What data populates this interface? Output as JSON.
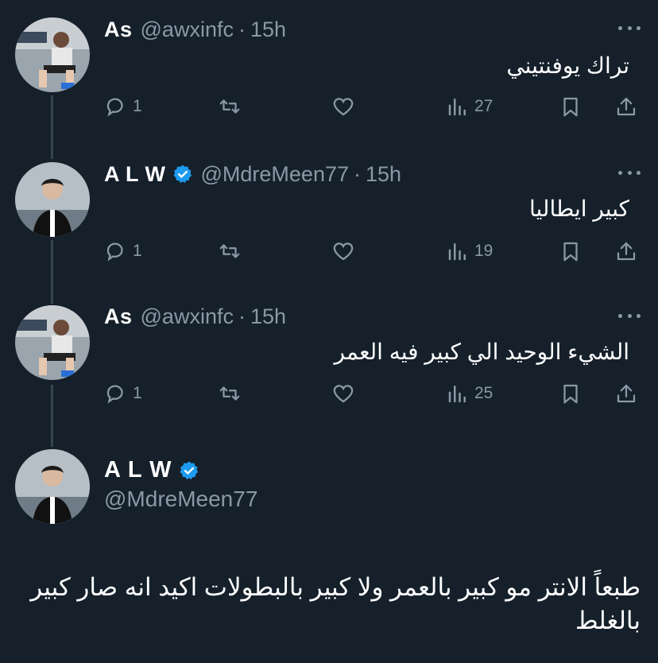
{
  "tweets": [
    {
      "name": "As",
      "handle": "@awxinfc",
      "time": "15h",
      "verified": false,
      "text": "تراك يوفنتيني",
      "replies": "1",
      "views": "27"
    },
    {
      "name": "A L W",
      "handle": "@MdreMeen77",
      "time": "15h",
      "verified": true,
      "text": "كبير ايطاليا",
      "replies": "1",
      "views": "19"
    },
    {
      "name": "As",
      "handle": "@awxinfc",
      "time": "15h",
      "verified": false,
      "text": "الشيء الوحيد الي كبير فيه العمر",
      "replies": "1",
      "views": "25"
    }
  ],
  "main": {
    "name": "A L W",
    "handle": "@MdreMeen77",
    "verified": true,
    "text": "طبعاً الانتر مو كبير بالعمر ولا كبير بالبطولات اكيد انه صار كبير بالغلط"
  },
  "icons": {
    "reply": "reply-icon",
    "retweet": "retweet-icon",
    "like": "heart-icon",
    "views": "views-icon",
    "bookmark": "bookmark-icon",
    "share": "share-icon",
    "verified": "verified-badge-icon",
    "more": "more-dots-icon"
  },
  "colors": {
    "background": "#15202b",
    "muted": "#8b98a5",
    "verified": "#1d9bf0",
    "thread_line": "#38444d"
  }
}
